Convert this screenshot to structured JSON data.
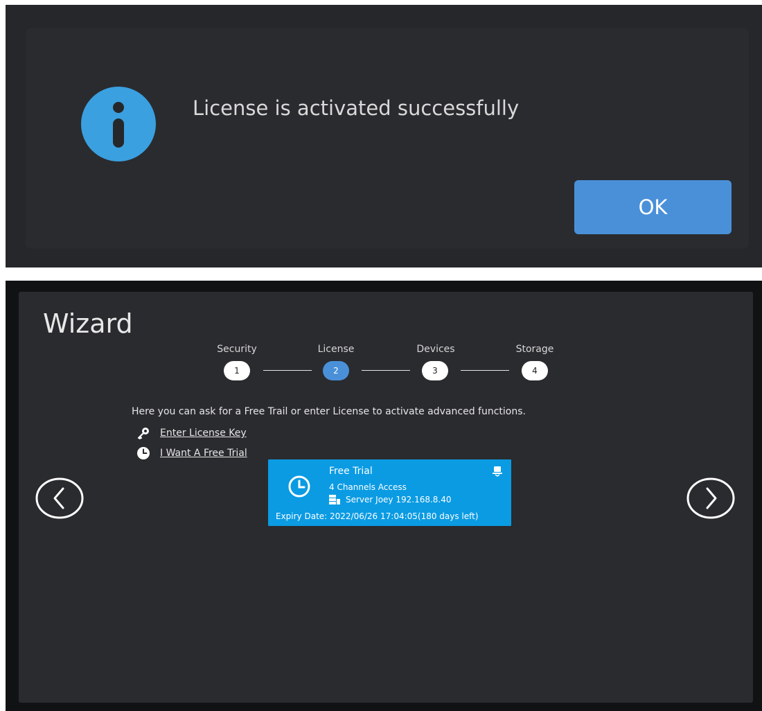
{
  "dialog": {
    "message": "License is activated successfully",
    "ok_label": "OK",
    "icon": "info-icon",
    "accent_color": "#4a90d9"
  },
  "wizard": {
    "title": "Wizard",
    "steps": [
      {
        "label": "Security",
        "number": "1",
        "active": false
      },
      {
        "label": "License",
        "number": "2",
        "active": true
      },
      {
        "label": "Devices",
        "number": "3",
        "active": false
      },
      {
        "label": "Storage",
        "number": "4",
        "active": false
      }
    ],
    "description": "Here you can ask for a Free Trail or enter License to activate advanced functions.",
    "options": [
      {
        "label": "Enter License Key",
        "icon": "key-icon"
      },
      {
        "label": "I Want A Free Trial",
        "icon": "clock-icon"
      }
    ],
    "card": {
      "title": "Free Trial",
      "channels": "4 Channels Access",
      "server": "Server Joey 192.168.8.40",
      "expiry": "Expiry Date: 2022/06/26 17:04:05(180 days left)",
      "color": "#0a9be3"
    },
    "nav": {
      "prev_icon": "chevron-left-icon",
      "next_icon": "chevron-right-icon"
    }
  }
}
